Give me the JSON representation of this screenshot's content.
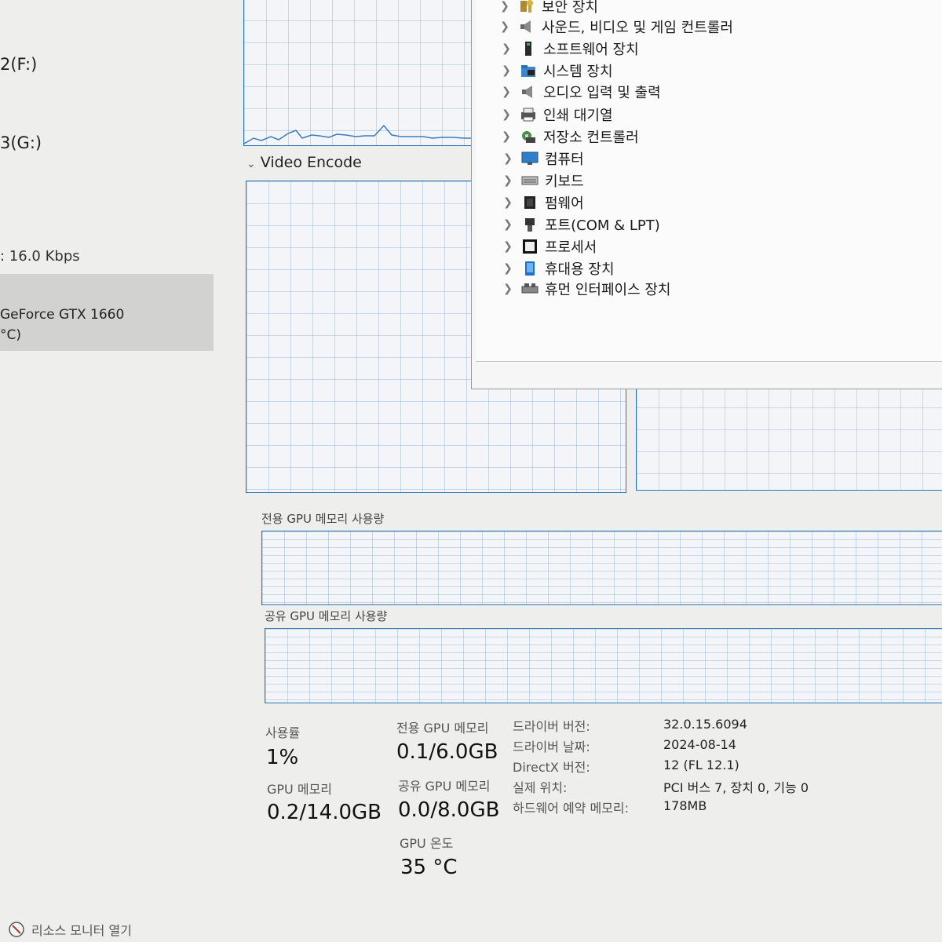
{
  "sidebar": {
    "drive_f": "2(F:)",
    "drive_g": "3(G:)",
    "network_rate": ": 16.0 Kbps",
    "gpu_name": "GeForce GTX 1660",
    "gpu_sub": "°C)"
  },
  "graphs": {
    "video_encode_label": "Video Encode",
    "dedicated_label": "전용 GPU 메모리 사용량",
    "shared_label": "공유 GPU 메모리 사용량"
  },
  "device_manager": {
    "items": [
      {
        "label": "보안 장치",
        "icon": "security-key-icon"
      },
      {
        "label": "사운드, 비디오 및 게임 컨트롤러",
        "icon": "speaker-icon"
      },
      {
        "label": "소프트웨어 장치",
        "icon": "software-device-icon"
      },
      {
        "label": "시스템 장치",
        "icon": "system-folder-icon"
      },
      {
        "label": "오디오 입력 및 출력",
        "icon": "speaker-icon"
      },
      {
        "label": "인쇄 대기열",
        "icon": "printer-icon"
      },
      {
        "label": "저장소 컨트롤러",
        "icon": "storage-controller-icon"
      },
      {
        "label": "컴퓨터",
        "icon": "monitor-icon"
      },
      {
        "label": "키보드",
        "icon": "keyboard-icon"
      },
      {
        "label": "펌웨어",
        "icon": "chip-icon"
      },
      {
        "label": "포트(COM & LPT)",
        "icon": "port-icon"
      },
      {
        "label": "프로세서",
        "icon": "processor-icon"
      },
      {
        "label": "휴대용 장치",
        "icon": "portable-device-icon"
      },
      {
        "label": "휴먼 인터페이스 장치",
        "icon": "hid-icon"
      }
    ]
  },
  "stats": {
    "usage_label": "사용률",
    "usage_value": "1%",
    "dedicated_mem_label": "전용 GPU 메모리",
    "dedicated_mem_value": "0.1/6.0GB",
    "gpu_mem_label": "GPU 메모리",
    "gpu_mem_value": "0.2/14.0GB",
    "shared_mem_label": "공유 GPU 메모리",
    "shared_mem_value": "0.0/8.0GB",
    "temp_label": "GPU 온도",
    "temp_value": "35 °C"
  },
  "driver_info": [
    {
      "key": "드라이버 버전:",
      "value": "32.0.15.6094"
    },
    {
      "key": "드라이버 날짜:",
      "value": "2024-08-14"
    },
    {
      "key": "DirectX 버전:",
      "value": "12 (FL 12.1)"
    },
    {
      "key": "실제 위치:",
      "value": "PCI 버스 7, 장치 0, 기능 0"
    },
    {
      "key": "하드웨어 예약 메모리:",
      "value": "178MB"
    }
  ],
  "footer": {
    "resmon_link": "리소스 모니터 열기"
  },
  "colors": {
    "graph_border": "#2a76b8",
    "graph_line": "#3a7cc0",
    "selected_row": "#d2d2d0"
  }
}
